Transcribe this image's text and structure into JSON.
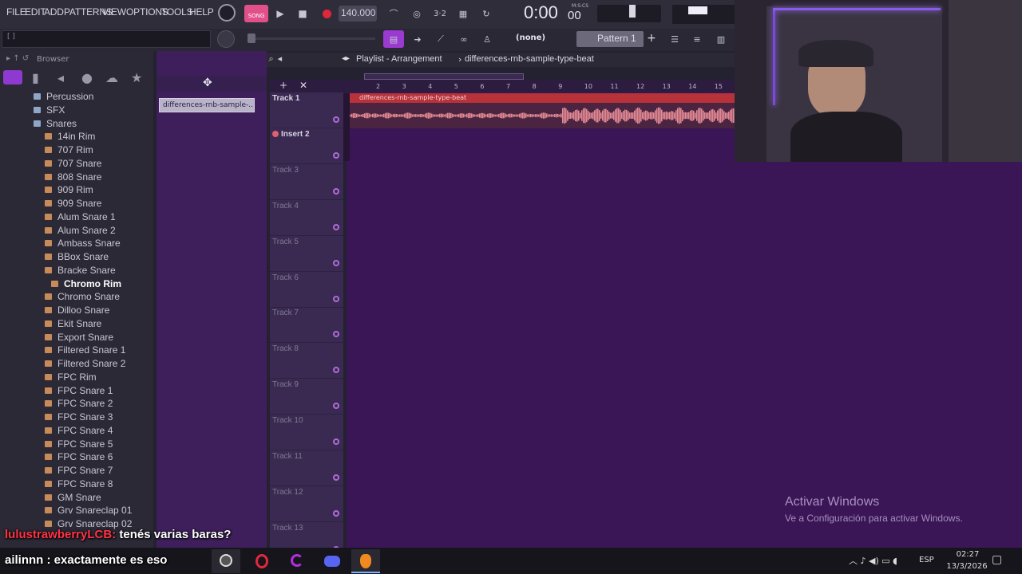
{
  "menu": [
    "FILE",
    "EDIT",
    "ADD",
    "PATTERNS",
    "VIEW",
    "OPTIONS",
    "TOOLS",
    "HELP"
  ],
  "transport": {
    "mode_label": "SONG",
    "tempo": "140.000",
    "time": "0:00",
    "time_small": "00",
    "time_unit": "M:S:CS"
  },
  "toolbar2": {
    "snap": "(none)",
    "pattern": "Pattern 1"
  },
  "hint": "[ ]",
  "browser": {
    "title": "Browser",
    "folders": [
      "Percussion",
      "SFX",
      "Snares"
    ],
    "items": [
      "14in Rim",
      "707 Rim",
      "707 Snare",
      "808 Snare",
      "909 Rim",
      "909 Snare",
      "Alum Snare 1",
      "Alum Snare 2",
      "Ambass Snare",
      "BBox Snare",
      "Bracke Snare",
      "Chromo Rim",
      "Chromo Snare",
      "Dilloo Snare",
      "Ekit Snare",
      "Export Snare",
      "Filtered Snare 1",
      "Filtered Snare 2",
      "FPC Rim",
      "FPC Snare 1",
      "FPC Snare 2",
      "FPC Snare 3",
      "FPC Snare 4",
      "FPC Snare 5",
      "FPC Snare 6",
      "FPC Snare 7",
      "FPC Snare 8",
      "GM Snare",
      "Grv Snareclap 01",
      "Grv Snareclap 02"
    ]
  },
  "playlist": {
    "title": "Playlist - Arrangement",
    "sep": "›",
    "song": "differences-rnb-sample-type-beat",
    "clip_picker": "differences-rnb-sample-...",
    "clip_label": "differences-rnb-sample-type-beat",
    "ruler": [
      "2",
      "3",
      "4",
      "5",
      "6",
      "7",
      "8",
      "9",
      "10",
      "11",
      "12",
      "13",
      "14",
      "15"
    ],
    "tracks": [
      "Track 1",
      "Insert 2",
      "Track 3",
      "Track 4",
      "Track 5",
      "Track 6",
      "Track 7",
      "Track 8",
      "Track 9",
      "Track 10",
      "Track 11",
      "Track 12",
      "Track 13"
    ]
  },
  "watermark": {
    "title": "Activar Windows",
    "subtitle": "Ve a Configuración para activar Windows."
  },
  "chat": [
    {
      "user": "lulustrawberryLCB:",
      "message": "tenés varias baras?",
      "user_color": "#ff3344"
    },
    {
      "user": "ailinnn :",
      "message": "exactamente es eso",
      "user_color": "#ffffff"
    }
  ],
  "taskbar": {
    "lang": "ESP",
    "time": "02:27",
    "date": "13/3/2026"
  },
  "colors": {
    "accent": "#b06ad8",
    "clip": "#b8323a",
    "playlist_bg": "#3a1656"
  }
}
